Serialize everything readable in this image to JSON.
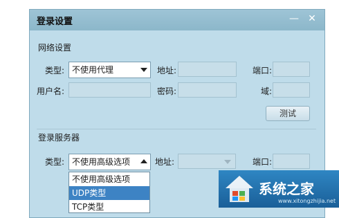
{
  "window": {
    "title": "登录设置"
  },
  "network": {
    "section_title": "网络设置",
    "type_label": "类型:",
    "type_value": "不使用代理",
    "address_label": "地址:",
    "port_label": "端口:",
    "username_label": "用户名:",
    "password_label": "密码:",
    "domain_label": "域:",
    "test_button": "测试"
  },
  "server": {
    "section_title": "登录服务器",
    "type_label": "类型:",
    "type_value": "不使用高级选项",
    "address_label": "地址:",
    "port_label": "端口:",
    "options": [
      "不使用高级选项",
      "UDP类型",
      "TCP类型"
    ],
    "selected_index": 1
  },
  "watermark": {
    "brand": "系统之家",
    "url": "www.xitongzhijia.net"
  }
}
